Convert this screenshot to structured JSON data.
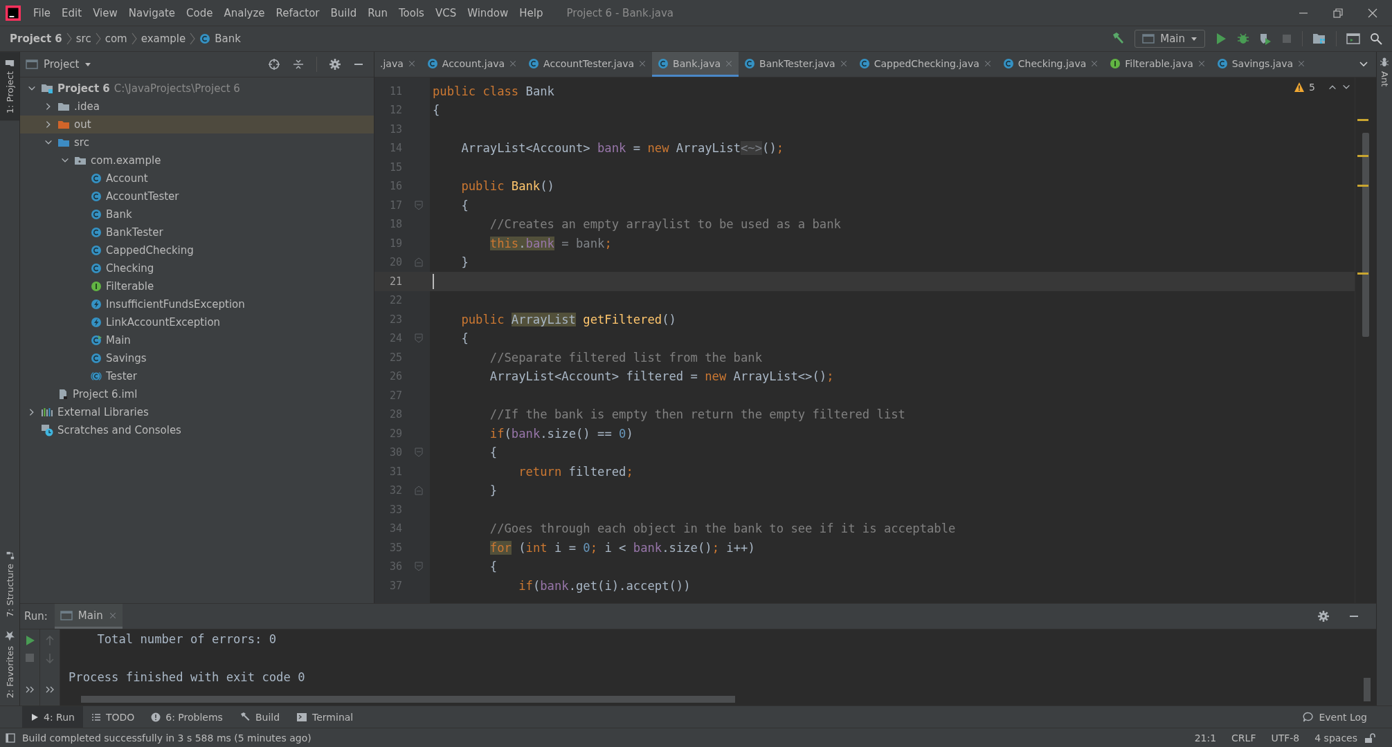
{
  "menu_bar": {
    "items": [
      "File",
      "Edit",
      "View",
      "Navigate",
      "Code",
      "Analyze",
      "Refactor",
      "Build",
      "Run",
      "Tools",
      "VCS",
      "Window",
      "Help"
    ],
    "title": "Project 6 - Bank.java"
  },
  "navigation_bar": {
    "breadcrumbs": [
      {
        "label": "Project 6",
        "kind": "module"
      },
      {
        "label": "src",
        "kind": "folder"
      },
      {
        "label": "com",
        "kind": "folder"
      },
      {
        "label": "example",
        "kind": "package"
      },
      {
        "label": "Bank",
        "kind": "class"
      }
    ],
    "run_configuration": "Main"
  },
  "left_stripe": {
    "top": [
      {
        "label": "1: Project",
        "selected": true
      }
    ],
    "bottom": [
      {
        "label": "7: Structure",
        "selected": false
      },
      {
        "label": "2: Favorites",
        "selected": false
      }
    ]
  },
  "right_stripe": [
    {
      "label": "Ant",
      "selected": false
    }
  ],
  "project_panel": {
    "title": "Project",
    "tree": [
      {
        "label": "Project 6",
        "detail": "C:\\JavaProjects\\Project 6",
        "kind": "module",
        "expanded": true,
        "selected": false,
        "children": [
          {
            "label": ".idea",
            "kind": "folder",
            "expanded": false,
            "selected": false
          },
          {
            "label": "out",
            "kind": "excluded-folder",
            "expanded": false,
            "selected": true
          },
          {
            "label": "src",
            "kind": "source-folder",
            "expanded": true,
            "selected": false,
            "children": [
              {
                "label": "com.example",
                "kind": "package",
                "expanded": true,
                "selected": false,
                "children": [
                  {
                    "label": "Account",
                    "kind": "class",
                    "selected": false
                  },
                  {
                    "label": "AccountTester",
                    "kind": "class",
                    "selected": false
                  },
                  {
                    "label": "Bank",
                    "kind": "class",
                    "selected": false
                  },
                  {
                    "label": "BankTester",
                    "kind": "class",
                    "selected": false
                  },
                  {
                    "label": "CappedChecking",
                    "kind": "class",
                    "selected": false
                  },
                  {
                    "label": "Checking",
                    "kind": "class",
                    "selected": false
                  },
                  {
                    "label": "Filterable",
                    "kind": "interface",
                    "selected": false
                  },
                  {
                    "label": "InsufficientFundsException",
                    "kind": "exception",
                    "selected": false
                  },
                  {
                    "label": "LinkAccountException",
                    "kind": "exception",
                    "selected": false
                  },
                  {
                    "label": "Main",
                    "kind": "main-class",
                    "selected": false
                  },
                  {
                    "label": "Savings",
                    "kind": "class",
                    "selected": false
                  },
                  {
                    "label": "Tester",
                    "kind": "abstract-class",
                    "selected": false
                  }
                ]
              }
            ]
          },
          {
            "label": "Project 6.iml",
            "kind": "module-file",
            "selected": false
          }
        ]
      },
      {
        "label": "External Libraries",
        "kind": "libraries",
        "expanded": false,
        "selected": false
      },
      {
        "label": "Scratches and Consoles",
        "kind": "scratches",
        "selected": false
      }
    ]
  },
  "editor": {
    "tabs": [
      {
        "label": ".java",
        "kind": "file",
        "selected": false
      },
      {
        "label": "Account.java",
        "kind": "class",
        "selected": false
      },
      {
        "label": "AccountTester.java",
        "kind": "class",
        "selected": false
      },
      {
        "label": "Bank.java",
        "kind": "class",
        "selected": true
      },
      {
        "label": "BankTester.java",
        "kind": "class",
        "selected": false
      },
      {
        "label": "CappedChecking.java",
        "kind": "class",
        "selected": false
      },
      {
        "label": "Checking.java",
        "kind": "class",
        "selected": false
      },
      {
        "label": "Filterable.java",
        "kind": "interface",
        "selected": false
      },
      {
        "label": "Savings.java",
        "kind": "class",
        "selected": false
      }
    ],
    "warnings": "5",
    "lines": [
      {
        "number": "11",
        "kind": "plain",
        "selected": false,
        "tokens": [
          {
            "kind": "keyword",
            "text": "public class",
            "highlighted": false
          },
          {
            "kind": "plain",
            "text": " Bank",
            "highlighted": false
          }
        ]
      },
      {
        "number": "12",
        "kind": "plain",
        "selected": false,
        "tokens": [
          {
            "kind": "plain",
            "text": "{",
            "highlighted": false
          }
        ]
      },
      {
        "number": "13",
        "kind": "plain",
        "selected": false
      },
      {
        "number": "14",
        "kind": "plain",
        "selected": false,
        "tokens": [
          {
            "kind": "plain",
            "text": "    ArrayList<Account> ",
            "highlighted": false
          },
          {
            "kind": "field",
            "text": "bank",
            "highlighted": false
          },
          {
            "kind": "plain",
            "text": " = ",
            "highlighted": false
          },
          {
            "kind": "keyword",
            "text": "new",
            "highlighted": false
          },
          {
            "kind": "plain",
            "text": " ArrayList",
            "highlighted": false
          },
          {
            "kind": "hint",
            "text": "<~>",
            "highlighted": false
          },
          {
            "kind": "plain",
            "text": "()",
            "highlighted": false
          },
          {
            "kind": "keyword",
            "text": ";",
            "highlighted": false
          }
        ]
      },
      {
        "number": "15",
        "kind": "plain",
        "selected": false
      },
      {
        "number": "16",
        "kind": "plain",
        "selected": false,
        "tokens": [
          {
            "kind": "keyword",
            "text": "    public ",
            "highlighted": false
          },
          {
            "kind": "method",
            "text": "Bank",
            "highlighted": false
          },
          {
            "kind": "plain",
            "text": "()",
            "highlighted": false
          }
        ]
      },
      {
        "number": "17",
        "kind": "fold-start",
        "selected": false,
        "tokens": [
          {
            "kind": "plain",
            "text": "    {",
            "highlighted": false
          }
        ]
      },
      {
        "number": "18",
        "kind": "plain",
        "selected": false,
        "tokens": [
          {
            "kind": "comment",
            "text": "        //Creates an empty arraylist to be used as a bank",
            "highlighted": false
          }
        ]
      },
      {
        "number": "19",
        "kind": "plain",
        "selected": false,
        "tokens": [
          {
            "kind": "keyword",
            "text": "        this",
            "highlighted": true
          },
          {
            "kind": "plain",
            "text": ".",
            "highlighted": true
          },
          {
            "kind": "field",
            "text": "bank",
            "highlighted": true
          },
          {
            "kind": "muted",
            "text": " = bank",
            "highlighted": false
          },
          {
            "kind": "keyword",
            "text": ";",
            "highlighted": false
          }
        ]
      },
      {
        "number": "20",
        "kind": "fold-end",
        "selected": false,
        "tokens": [
          {
            "kind": "plain",
            "text": "    }",
            "highlighted": false
          }
        ]
      },
      {
        "number": "21",
        "kind": "plain",
        "selected": true
      },
      {
        "number": "22",
        "kind": "plain",
        "selected": false
      },
      {
        "number": "23",
        "kind": "plain",
        "selected": false,
        "tokens": [
          {
            "kind": "keyword",
            "text": "    public ",
            "highlighted": false
          },
          {
            "kind": "plain",
            "text": "ArrayList",
            "highlighted": true
          },
          {
            "kind": "method",
            "text": " getFiltered",
            "highlighted": false
          },
          {
            "kind": "plain",
            "text": "()",
            "highlighted": false
          }
        ]
      },
      {
        "number": "24",
        "kind": "fold-start",
        "selected": false,
        "tokens": [
          {
            "kind": "plain",
            "text": "    {",
            "highlighted": false
          }
        ]
      },
      {
        "number": "25",
        "kind": "plain",
        "selected": false,
        "tokens": [
          {
            "kind": "comment",
            "text": "        //Separate filtered list from the bank",
            "highlighted": false
          }
        ]
      },
      {
        "number": "26",
        "kind": "plain",
        "selected": false,
        "tokens": [
          {
            "kind": "plain",
            "text": "        ArrayList<Account> filtered = ",
            "highlighted": false
          },
          {
            "kind": "keyword",
            "text": "new",
            "highlighted": false
          },
          {
            "kind": "plain",
            "text": " ArrayList<>()",
            "highlighted": false
          },
          {
            "kind": "keyword",
            "text": ";",
            "highlighted": false
          }
        ]
      },
      {
        "number": "27",
        "kind": "plain",
        "selected": false
      },
      {
        "number": "28",
        "kind": "plain",
        "selected": false,
        "tokens": [
          {
            "kind": "comment",
            "text": "        //If the bank is empty then return the empty filtered list",
            "highlighted": false
          }
        ]
      },
      {
        "number": "29",
        "kind": "plain",
        "selected": false,
        "tokens": [
          {
            "kind": "keyword",
            "text": "        if",
            "highlighted": false
          },
          {
            "kind": "plain",
            "text": "(",
            "highlighted": false
          },
          {
            "kind": "field",
            "text": "bank",
            "highlighted": false
          },
          {
            "kind": "plain",
            "text": ".size() == ",
            "highlighted": false
          },
          {
            "kind": "number",
            "text": "0",
            "highlighted": false
          },
          {
            "kind": "plain",
            "text": ")",
            "highlighted": false
          }
        ]
      },
      {
        "number": "30",
        "kind": "fold-start",
        "selected": false,
        "tokens": [
          {
            "kind": "plain",
            "text": "        {",
            "highlighted": false
          }
        ]
      },
      {
        "number": "31",
        "kind": "plain",
        "selected": false,
        "tokens": [
          {
            "kind": "keyword",
            "text": "            return",
            "highlighted": false
          },
          {
            "kind": "plain",
            "text": " filtered",
            "highlighted": false
          },
          {
            "kind": "keyword",
            "text": ";",
            "highlighted": false
          }
        ]
      },
      {
        "number": "32",
        "kind": "fold-end",
        "selected": false,
        "tokens": [
          {
            "kind": "plain",
            "text": "        }",
            "highlighted": false
          }
        ]
      },
      {
        "number": "33",
        "kind": "plain",
        "selected": false
      },
      {
        "number": "34",
        "kind": "plain",
        "selected": false,
        "tokens": [
          {
            "kind": "comment",
            "text": "        //Goes through each object in the bank to see if it is acceptable",
            "highlighted": false
          }
        ]
      },
      {
        "number": "35",
        "kind": "plain",
        "selected": false,
        "tokens": [
          {
            "kind": "keyword",
            "text": "        for",
            "highlighted": true
          },
          {
            "kind": "plain",
            "text": " (",
            "highlighted": false
          },
          {
            "kind": "keyword",
            "text": "int",
            "highlighted": false
          },
          {
            "kind": "plain",
            "text": " i = ",
            "highlighted": false
          },
          {
            "kind": "number",
            "text": "0",
            "highlighted": false
          },
          {
            "kind": "keyword",
            "text": ";",
            "highlighted": false
          },
          {
            "kind": "plain",
            "text": " i < ",
            "highlighted": false
          },
          {
            "kind": "field",
            "text": "bank",
            "highlighted": false
          },
          {
            "kind": "plain",
            "text": ".size()",
            "highlighted": false
          },
          {
            "kind": "keyword",
            "text": ";",
            "highlighted": false
          },
          {
            "kind": "plain",
            "text": " i++)",
            "highlighted": false
          }
        ]
      },
      {
        "number": "36",
        "kind": "fold-start",
        "selected": false,
        "tokens": [
          {
            "kind": "plain",
            "text": "        {",
            "highlighted": false
          }
        ]
      },
      {
        "number": "37",
        "kind": "plain",
        "selected": false,
        "tokens": [
          {
            "kind": "keyword",
            "text": "            if",
            "highlighted": false
          },
          {
            "kind": "plain",
            "text": "(",
            "highlighted": false
          },
          {
            "kind": "field",
            "text": "bank",
            "highlighted": false
          },
          {
            "kind": "plain",
            "text": ".get(i).accept())",
            "highlighted": false
          }
        ]
      }
    ]
  },
  "run_panel": {
    "label": "Run:",
    "tabs": [
      {
        "label": "Main",
        "selected": true
      }
    ],
    "output": [
      {
        "kind": "stdout",
        "text": "    Total number of errors: 0"
      },
      {
        "kind": "exit",
        "text": "Process finished with exit code 0"
      }
    ]
  },
  "tool_window_bar": {
    "tabs": [
      {
        "label": "4: Run",
        "kind": "run",
        "selected": true
      },
      {
        "label": "TODO",
        "kind": "list",
        "selected": false
      },
      {
        "label": "6: Problems",
        "kind": "problems",
        "selected": false
      },
      {
        "label": "Build",
        "kind": "build",
        "selected": false
      },
      {
        "label": "Terminal",
        "kind": "terminal",
        "selected": false
      }
    ],
    "event_log": "Event Log"
  },
  "status_bar": {
    "message": "Build completed successfully in 3 s 588 ms (5 minutes ago)",
    "items": [
      "21:1",
      "CRLF",
      "UTF-8",
      "4 spaces"
    ]
  }
}
